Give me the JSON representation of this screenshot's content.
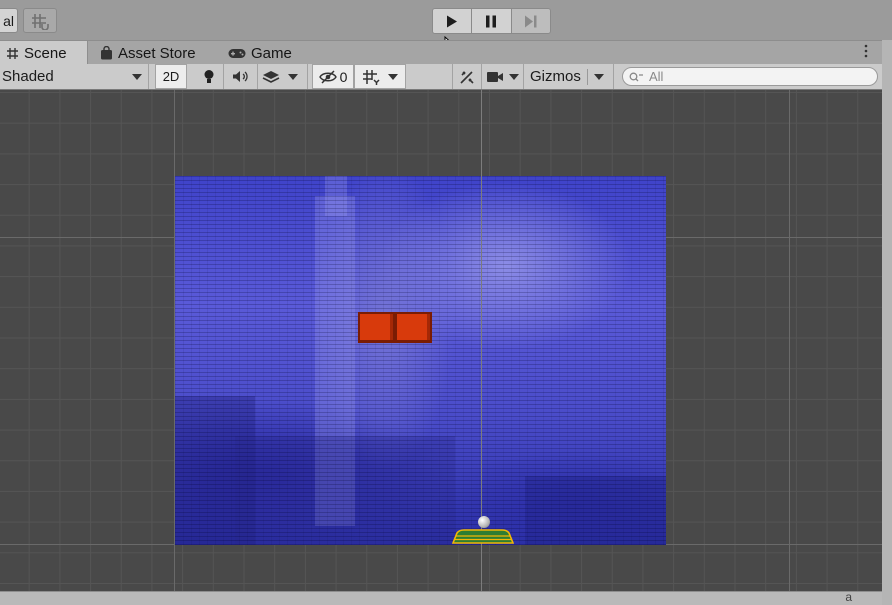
{
  "toolbar": {
    "pivot_label": "al",
    "play_icon": "play-icon",
    "pause_icon": "pause-icon",
    "step_icon": "step-icon"
  },
  "tabs": [
    {
      "label": "Scene",
      "icon": "grid-icon",
      "active": true
    },
    {
      "label": "Asset Store",
      "icon": "bag-icon",
      "active": false
    },
    {
      "label": "Game",
      "icon": "gamepad-icon",
      "active": false
    }
  ],
  "scene_toolbar": {
    "shading_mode": "Shaded",
    "mode_2d": "2D",
    "hidden_count": "0",
    "gizmos_label": "Gizmos",
    "search_placeholder": "All"
  },
  "bottom_glyph": "a",
  "colors": {
    "brick": "#d83a0c",
    "background_blue": "#4a4cc9",
    "paddle_outline": "#f2b705",
    "paddle_fill": "#2e7d32"
  }
}
